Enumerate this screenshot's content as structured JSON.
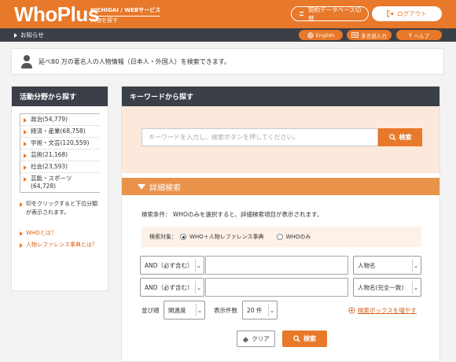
{
  "header": {
    "logo": "WhoPlus",
    "logo_sub_1": "NICHIGAI / WEBサービス",
    "logo_sub_2": "人物を探す",
    "switch_label": "契約データベース切替",
    "logout_label": "ログアウト"
  },
  "navbar": {
    "notice_label": "お知らせ",
    "english_label": "English",
    "multi_label": "多言語入力",
    "help_label": "ヘルプ"
  },
  "intro_text": "延べ80 万の著名人の人物情報（日本人・外国人）を検索できます。",
  "sidebar": {
    "title": "活動分野から探す",
    "categories": [
      "政治(54,779)",
      "経済・産業(68,758)",
      "学術・文芸(120,559)",
      "芸術(21,168)",
      "社会(23,593)",
      "芸能・スポーツ (64,728)"
    ],
    "hint": "印をクリックすると下位分類が表示されます。",
    "links": [
      "WHOとは？",
      "人物レファレンス事典とは？"
    ]
  },
  "main": {
    "title": "キーワードから探す",
    "keyword_placeholder": "キーワードを入力し、検索ボタンを押してください。",
    "search_label": "検索",
    "detail_title": "詳細検索",
    "condition_text": "検索条件： WHOのみを選択すると、詳細検索項目が表示されます。",
    "target_label": "検索対象：",
    "target_options": [
      "WHO＋人物レファレンス事典",
      "WHOのみ"
    ],
    "target_selected": "WHO＋人物レファレンス事典",
    "rows": [
      {
        "operator": "AND（必ず含む）",
        "value": "",
        "field": "人物名"
      },
      {
        "operator": "AND（必ず含む）",
        "value": "",
        "field": "人物名(完全一致)"
      }
    ],
    "sort_label": "並び順",
    "sort_value": "関連度",
    "count_label": "表示件数",
    "count_value": "20 件",
    "add_box_label": "検索ボックスを増やす",
    "clear_label": "クリア",
    "submit_label": "検索"
  },
  "colors": {
    "brand": "#e8782a",
    "dark": "#3b3f47",
    "pale": "#fde9dc"
  }
}
